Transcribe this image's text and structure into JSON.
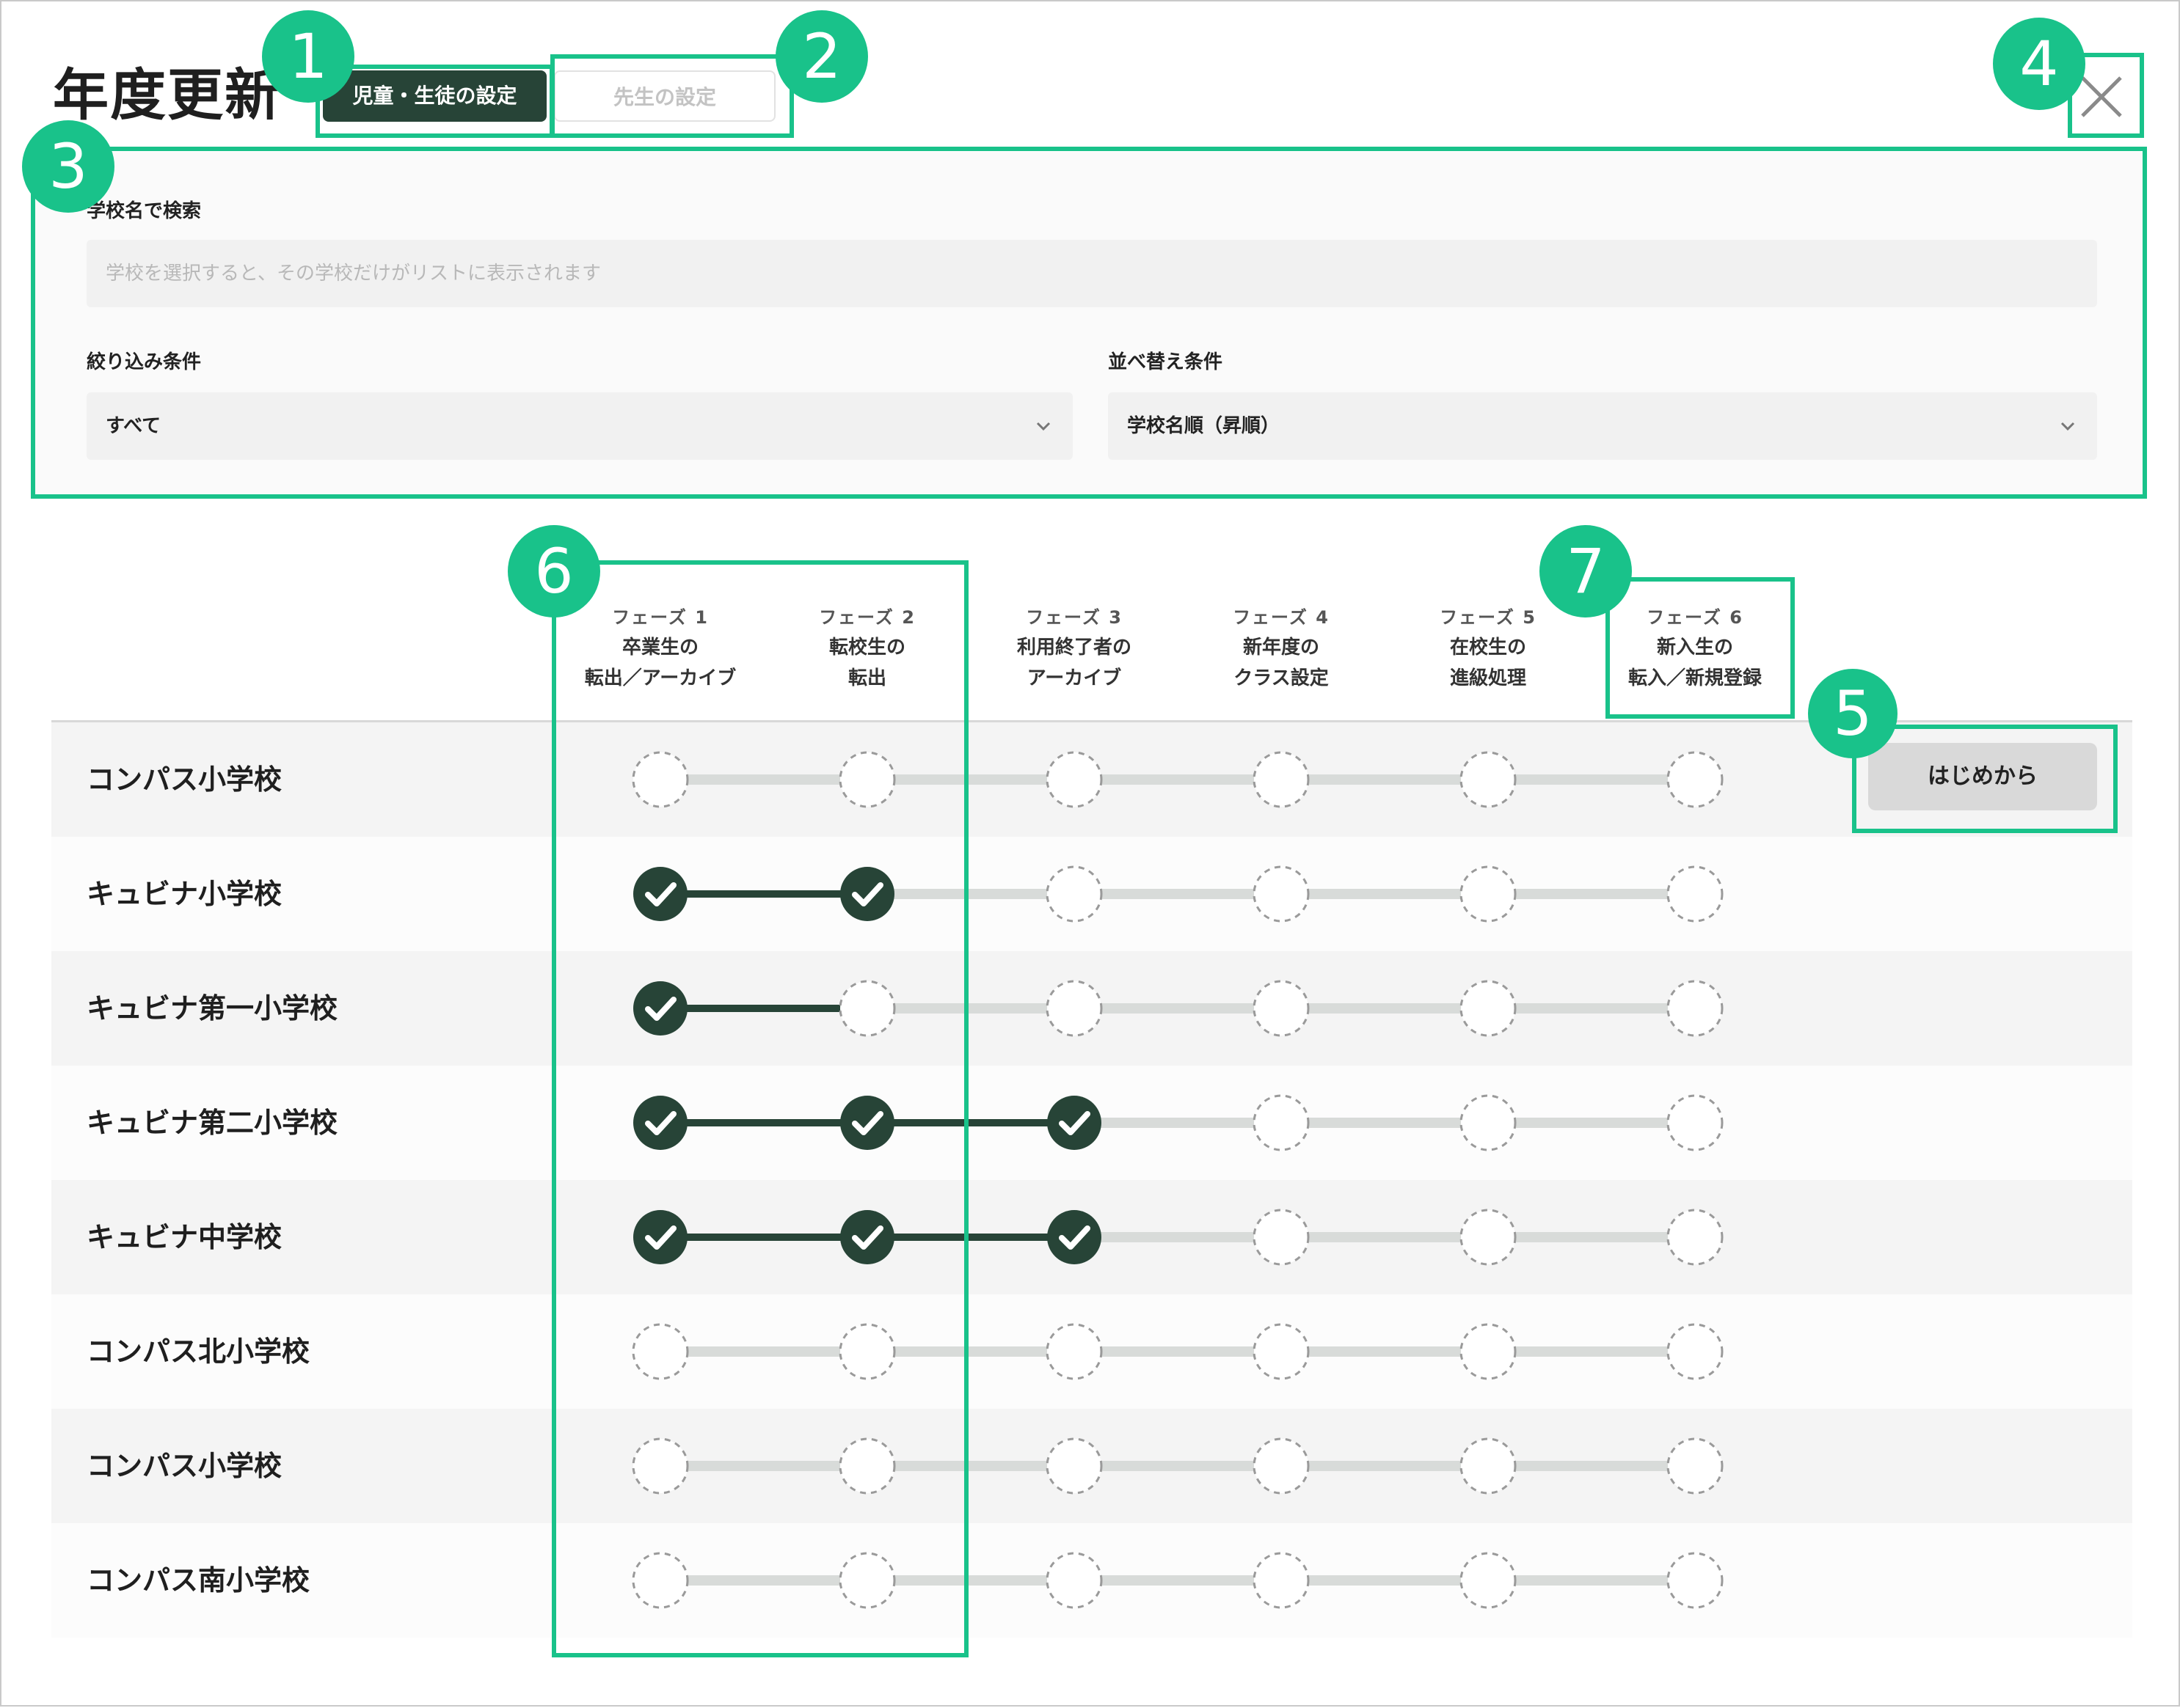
{
  "page": {
    "title": "年度更新"
  },
  "tabs": {
    "students": "児童・生徒の設定",
    "teachers": "先生の設定"
  },
  "close": {
    "icon": "close-icon"
  },
  "search": {
    "label": "学校名で検索",
    "placeholder": "学校を選択すると、その学校だけがリストに表示されます"
  },
  "filter": {
    "label": "絞り込み条件",
    "value": "すべて"
  },
  "sort": {
    "label": "並べ替え条件",
    "value": "学校名順（昇順）"
  },
  "phases": [
    {
      "num": "フェーズ 1",
      "line1": "卒業生の",
      "line2": "転出／アーカイブ"
    },
    {
      "num": "フェーズ 2",
      "line1": "転校生の",
      "line2": "転出"
    },
    {
      "num": "フェーズ 3",
      "line1": "利用終了者の",
      "line2": "アーカイブ"
    },
    {
      "num": "フェーズ 4",
      "line1": "新年度の",
      "line2": "クラス設定"
    },
    {
      "num": "フェーズ 5",
      "line1": "在校生の",
      "line2": "進級処理"
    },
    {
      "num": "フェーズ 6",
      "line1": "新入生の",
      "line2": "転入／新規登録"
    }
  ],
  "schools": [
    {
      "name": "コンパス小学校",
      "completed": 0
    },
    {
      "name": "キュビナ小学校",
      "completed": 2
    },
    {
      "name": "キュビナ第一小学校",
      "completed": 1
    },
    {
      "name": "キュビナ第二小学校",
      "completed": 3
    },
    {
      "name": "キュビナ中学校",
      "completed": 3
    },
    {
      "name": "コンパス北小学校",
      "completed": 0
    },
    {
      "name": "コンパス小学校",
      "completed": 0
    },
    {
      "name": "コンパス南小学校",
      "completed": 0
    }
  ],
  "restart_button": "はじめから",
  "annotations": [
    "1",
    "2",
    "3",
    "4",
    "5",
    "6",
    "7"
  ],
  "colors": {
    "accent": "#19c28a",
    "dark_green": "#274437",
    "track_gray": "#d8dbd9",
    "row_alt": "#f4f4f4"
  }
}
